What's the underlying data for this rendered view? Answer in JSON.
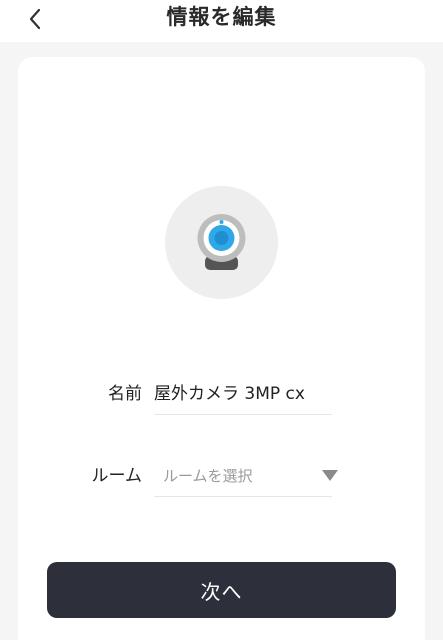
{
  "header": {
    "title": "情報を編集",
    "back_icon": "chevron-left-icon"
  },
  "device": {
    "icon": "webcam-icon",
    "icon_colors": {
      "ring": "#bdbdbd",
      "lens": "#2fa8e8",
      "base": "#555555",
      "circle_bg": "#eeeeee"
    }
  },
  "form": {
    "name_label": "名前",
    "name_value": "屋外カメラ 3MP cx",
    "room_label": "ルーム",
    "room_placeholder": "ルームを選択",
    "room_dropdown_icon": "triangle-down-icon"
  },
  "actions": {
    "next_label": "次へ"
  },
  "colors": {
    "background": "#f5f5f5",
    "card": "#ffffff",
    "button": "#2d2f3a",
    "button_text": "#ffffff"
  }
}
